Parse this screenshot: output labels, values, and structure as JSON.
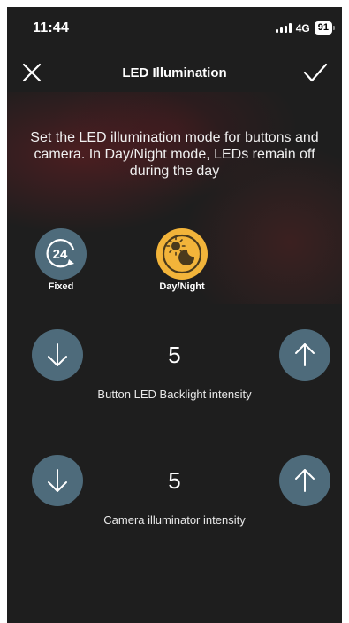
{
  "status_bar": {
    "time": "11:44",
    "network": "4G",
    "battery": "91"
  },
  "nav": {
    "title": "LED Illumination",
    "close_icon": "close-icon",
    "confirm_icon": "checkmark-icon"
  },
  "description": "Set the LED illumination mode for buttons and camera. In Day/Night mode, LEDs remain off during the day",
  "modes": [
    {
      "label": "Fixed",
      "icon": "24-hour-icon",
      "selected": false,
      "color": "#4e6b7b"
    },
    {
      "label": "Day/Night",
      "icon": "day-night-icon",
      "selected": true,
      "color": "#f2b43a"
    }
  ],
  "button_led": {
    "value": "5",
    "caption": "Button LED Backlight intensity"
  },
  "camera_illuminator": {
    "value": "5",
    "caption": "Camera illuminator intensity"
  },
  "colors": {
    "background": "#1e1e1e",
    "button": "#4e6b7b",
    "accent": "#f2b43a"
  }
}
